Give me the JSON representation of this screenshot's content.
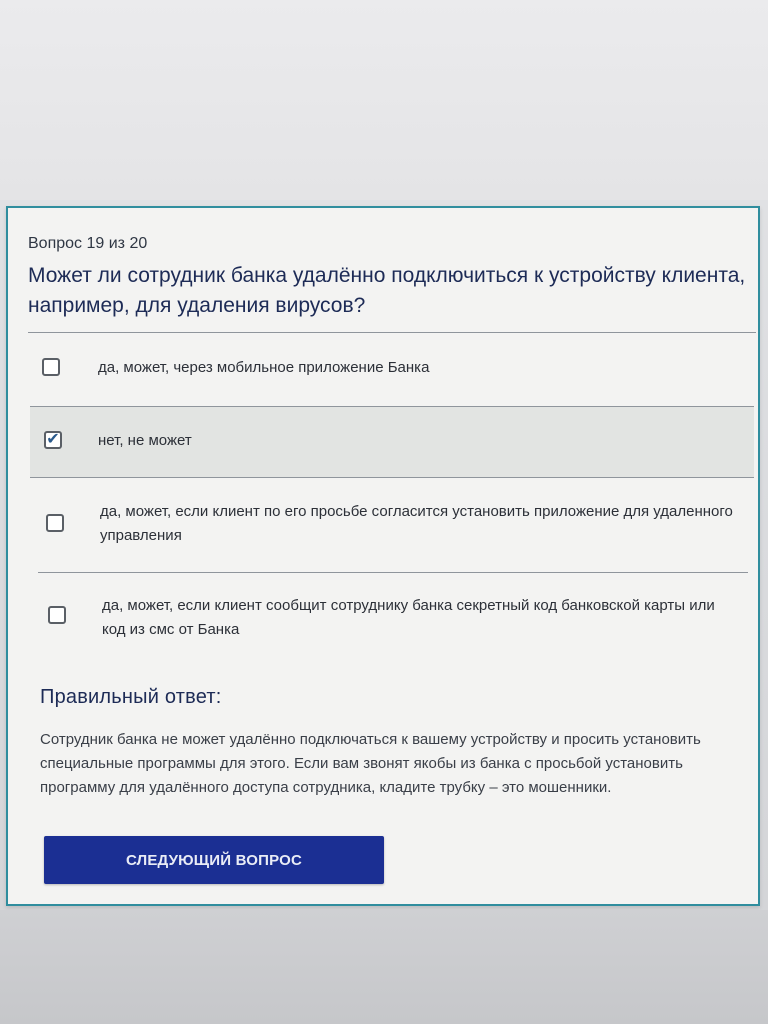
{
  "quiz": {
    "counter": "Вопрос 19 из 20",
    "question": "Может ли сотрудник банка удалённо подключиться к устройству клиента, например, для удаления вирусов?",
    "options": [
      {
        "label": "да, может, через мобильное приложение Банка",
        "checked": false
      },
      {
        "label": "нет, не может",
        "checked": true
      },
      {
        "label": "да, может, если клиент по его просьбе согласится установить приложение для удаленного управления",
        "checked": false
      },
      {
        "label": "да, может, если клиент сообщит сотруднику банка секретный код банковской карты или код из смс от Банка",
        "checked": false
      }
    ],
    "checkmark": "✔",
    "answer_title": "Правильный ответ:",
    "answer_text": "Сотрудник банка не может удалённо подключаться к вашему устройству и просить установить специальные программы для этого. Если вам звонят якобы из банка с просьбой установить программу для удалённого доступа сотрудника, кладите трубку – это мошенники.",
    "next_button": "СЛЕДУЮЩИЙ ВОПРОС"
  },
  "colors": {
    "card_border": "#2f8d9e",
    "heading": "#1d2b56",
    "button_bg": "#1b2f93",
    "selected_row": "#e2e4e2"
  }
}
